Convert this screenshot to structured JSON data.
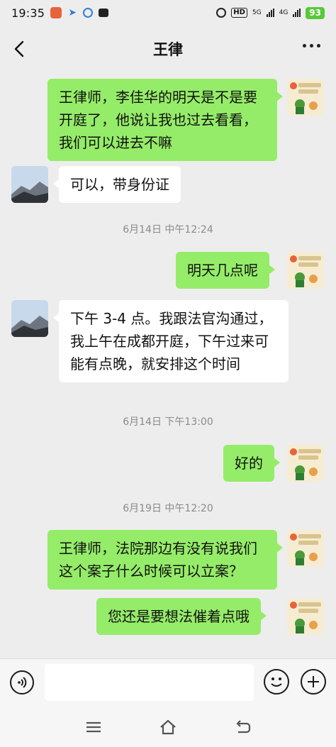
{
  "status_bar": {
    "time": "19:35",
    "hd_label": "HD",
    "network_top": "5G",
    "network_bottom": "4G",
    "battery": "93"
  },
  "header": {
    "title": "王律"
  },
  "messages": [
    {
      "type": "out",
      "text": "王律师，李佳华的明天是不是要开庭了，他说让我也过去看看，我们可以进去不嘛"
    },
    {
      "type": "in",
      "text": "可以，带身份证"
    },
    {
      "type": "time",
      "text": "6月14日 中午12:24"
    },
    {
      "type": "out",
      "text": "明天几点呢"
    },
    {
      "type": "in",
      "text": "下午 3-4 点。我跟法官沟通过，我上午在成都开庭，下午过来可能有点晚，就安排这个时间"
    },
    {
      "type": "time",
      "text": "6月14日 下午13:00"
    },
    {
      "type": "out",
      "text": "好的"
    },
    {
      "type": "time",
      "text": "6月19日 中午12:20"
    },
    {
      "type": "out",
      "text": "王律师，法院那边有没有说我们这个案子什么时候可以立案？"
    },
    {
      "type": "out",
      "text": "您还是要想法催着点哦"
    }
  ],
  "avatar_me_text": "阳光暖 照顾宝",
  "colors": {
    "out_bubble": "#95ec69",
    "in_bubble": "#ffffff",
    "background": "#ededed",
    "battery": "#59c93a"
  },
  "icons": {
    "back": "chevron-left-icon",
    "more": "more-dots-icon",
    "voice": "voice-icon",
    "emoji": "emoji-icon",
    "plus": "plus-icon",
    "nav_menu": "menu-icon",
    "nav_home": "home-icon",
    "nav_back": "back-nav-icon"
  }
}
